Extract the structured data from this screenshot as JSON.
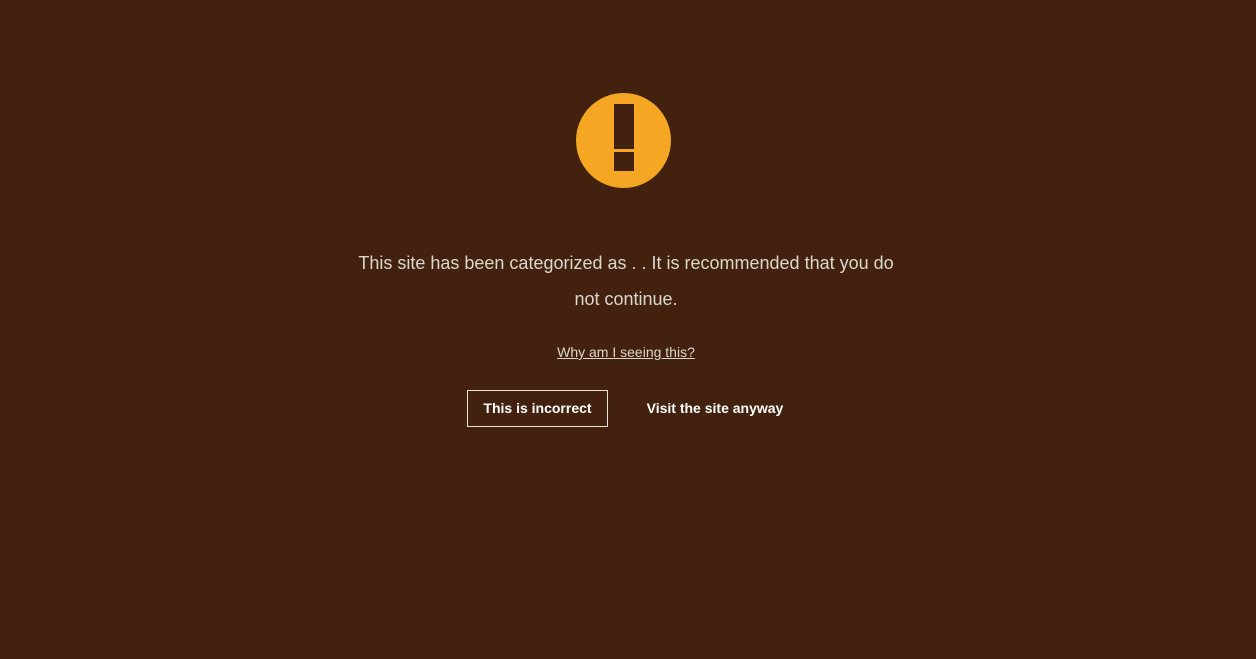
{
  "colors": {
    "background": "#42220f",
    "accent": "#f5a623",
    "text": "#ddd6cc"
  },
  "icon": "warning-exclamation-icon",
  "message": "This site has been categorized as . . It is recommended that you do not continue.",
  "why_link": "Why am I seeing this?",
  "buttons": {
    "incorrect": "This is incorrect",
    "visit": "Visit the site anyway"
  }
}
